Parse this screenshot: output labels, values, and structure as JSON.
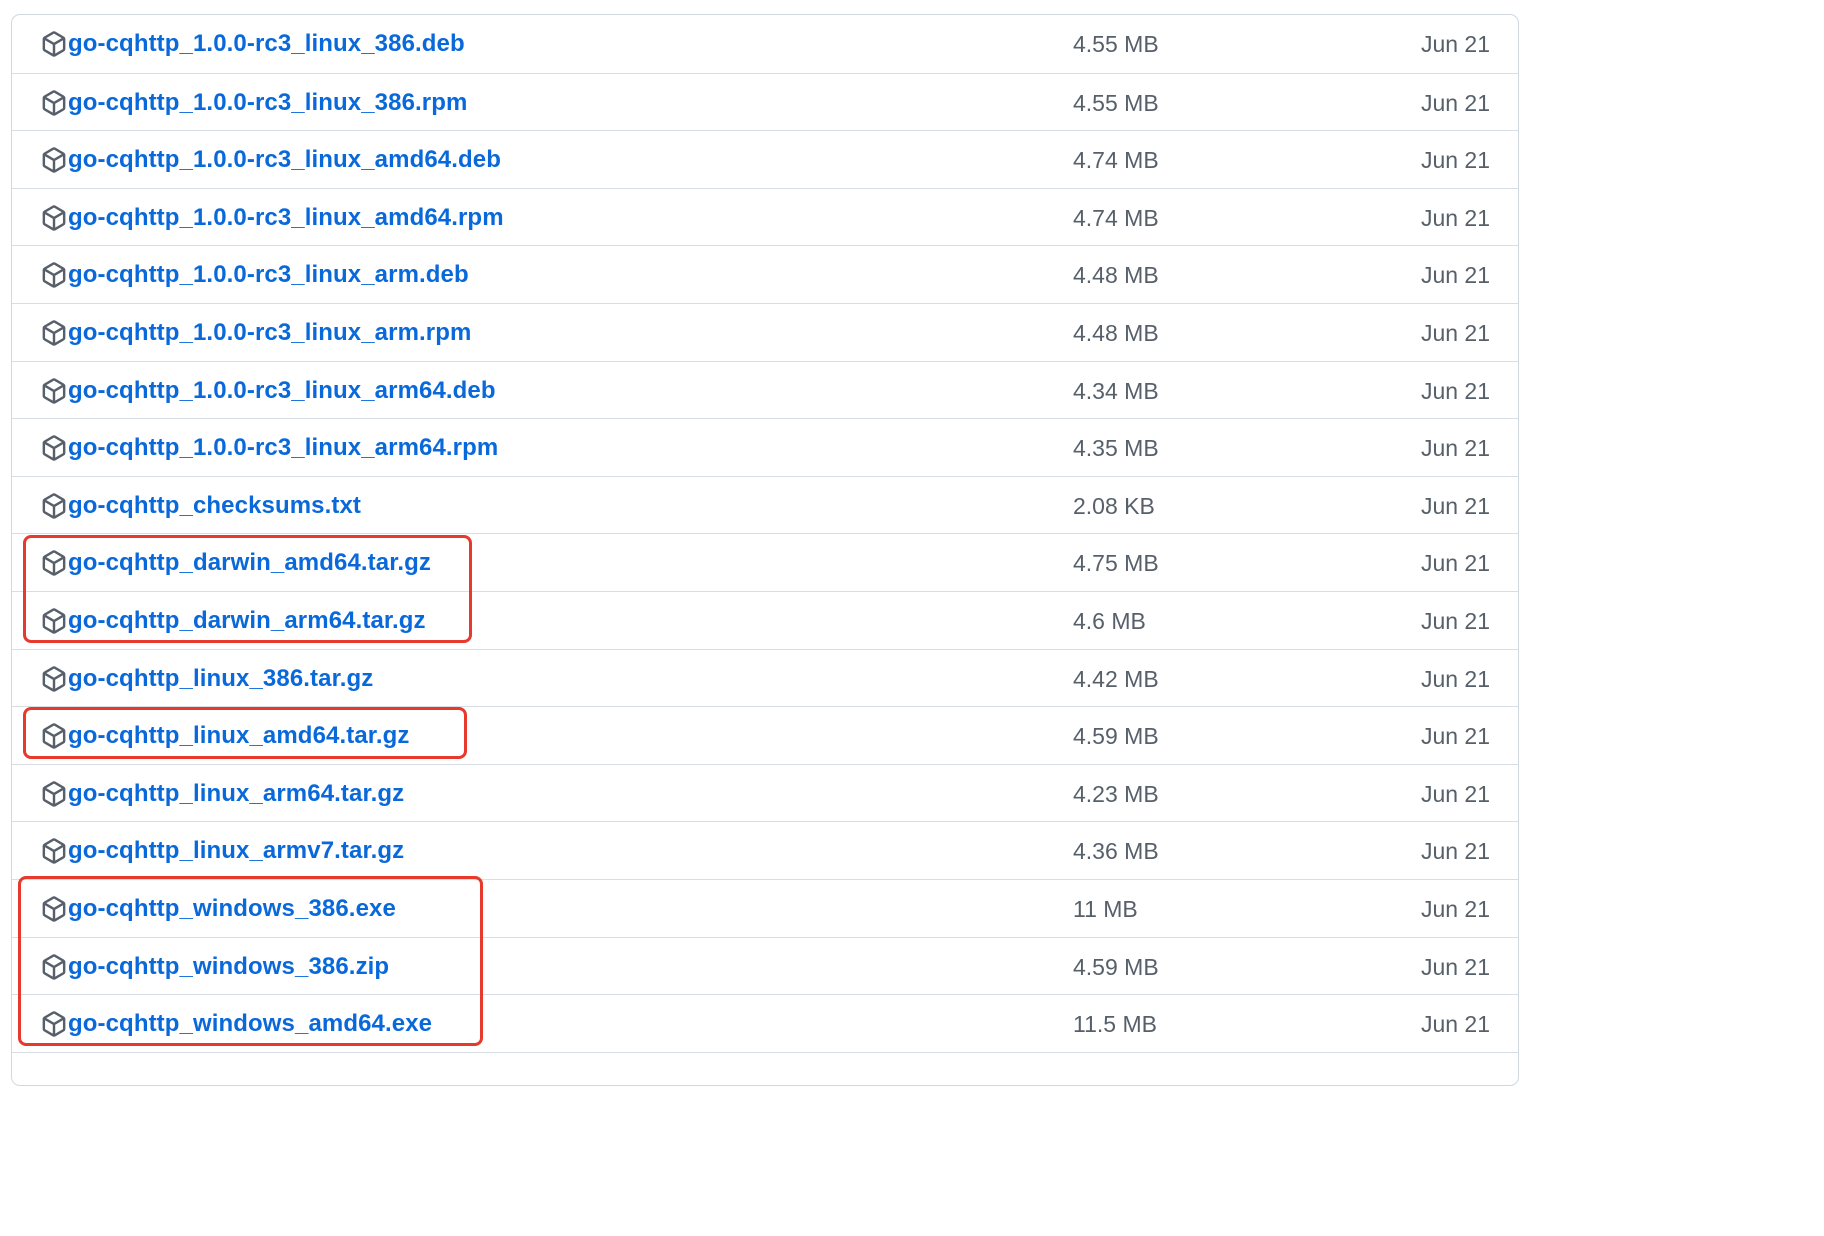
{
  "theme": {
    "link_color": "#0969da",
    "meta_color": "#57606a",
    "highlight_color": "#e8392d",
    "border_color": "#d0d7de"
  },
  "assets": [
    {
      "name": "go-cqhttp_1.0.0-rc3_linux_386.deb",
      "size": "4.55 MB",
      "date": "Jun 21",
      "icon": "package-icon"
    },
    {
      "name": "go-cqhttp_1.0.0-rc3_linux_386.rpm",
      "size": "4.55 MB",
      "date": "Jun 21",
      "icon": "package-icon"
    },
    {
      "name": "go-cqhttp_1.0.0-rc3_linux_amd64.deb",
      "size": "4.74 MB",
      "date": "Jun 21",
      "icon": "package-icon"
    },
    {
      "name": "go-cqhttp_1.0.0-rc3_linux_amd64.rpm",
      "size": "4.74 MB",
      "date": "Jun 21",
      "icon": "package-icon"
    },
    {
      "name": "go-cqhttp_1.0.0-rc3_linux_arm.deb",
      "size": "4.48 MB",
      "date": "Jun 21",
      "icon": "package-icon"
    },
    {
      "name": "go-cqhttp_1.0.0-rc3_linux_arm.rpm",
      "size": "4.48 MB",
      "date": "Jun 21",
      "icon": "package-icon"
    },
    {
      "name": "go-cqhttp_1.0.0-rc3_linux_arm64.deb",
      "size": "4.34 MB",
      "date": "Jun 21",
      "icon": "package-icon"
    },
    {
      "name": "go-cqhttp_1.0.0-rc3_linux_arm64.rpm",
      "size": "4.35 MB",
      "date": "Jun 21",
      "icon": "package-icon"
    },
    {
      "name": "go-cqhttp_checksums.txt",
      "size": "2.08 KB",
      "date": "Jun 21",
      "icon": "package-icon"
    },
    {
      "name": "go-cqhttp_darwin_amd64.tar.gz",
      "size": "4.75 MB",
      "date": "Jun 21",
      "icon": "package-icon"
    },
    {
      "name": "go-cqhttp_darwin_arm64.tar.gz",
      "size": "4.6 MB",
      "date": "Jun 21",
      "icon": "package-icon"
    },
    {
      "name": "go-cqhttp_linux_386.tar.gz",
      "size": "4.42 MB",
      "date": "Jun 21",
      "icon": "package-icon"
    },
    {
      "name": "go-cqhttp_linux_amd64.tar.gz",
      "size": "4.59 MB",
      "date": "Jun 21",
      "icon": "package-icon"
    },
    {
      "name": "go-cqhttp_linux_arm64.tar.gz",
      "size": "4.23 MB",
      "date": "Jun 21",
      "icon": "package-icon"
    },
    {
      "name": "go-cqhttp_linux_armv7.tar.gz",
      "size": "4.36 MB",
      "date": "Jun 21",
      "icon": "package-icon"
    },
    {
      "name": "go-cqhttp_windows_386.exe",
      "size": "11 MB",
      "date": "Jun 21",
      "icon": "package-icon"
    },
    {
      "name": "go-cqhttp_windows_386.zip",
      "size": "4.59 MB",
      "date": "Jun 21",
      "icon": "package-icon"
    },
    {
      "name": "go-cqhttp_windows_amd64.exe",
      "size": "11.5 MB",
      "date": "Jun 21",
      "icon": "package-icon"
    },
    {
      "name": "",
      "size": "",
      "date": "",
      "icon": "package-icon"
    }
  ]
}
